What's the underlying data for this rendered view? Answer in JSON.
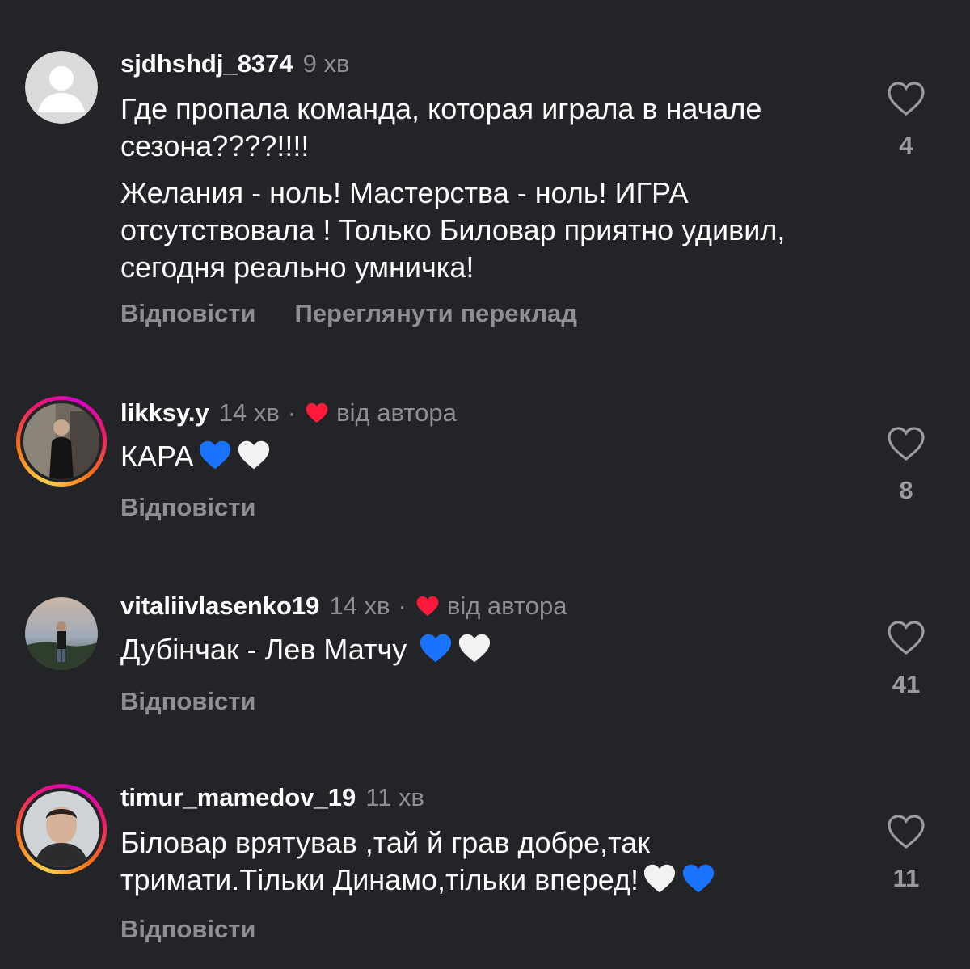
{
  "colors": {
    "background": "#232428",
    "muted_text": "#8e8e93",
    "author_heart": "#ff1a3c",
    "blue_heart": "#1a73ff",
    "white_heart": "#f2f2f2"
  },
  "comments": [
    {
      "username": "sjdhshdj_8374",
      "time": "9 хв",
      "paragraphs": [
        "Где пропала команда, которая играла в начале сезона????!!!!",
        "Желания - ноль! Мастерства - ноль! ИГРА отсутствовала ! Только Биловар приятно удивил, сегодня реально умничка!"
      ],
      "reply_label": "Відповісти",
      "translate_label": "Переглянути переклад",
      "likes": "4",
      "avatar_icon": "default-avatar-icon"
    },
    {
      "username": "likksy.y",
      "time": "14 хв",
      "separator": "·",
      "author_label": "від автора",
      "text": "КАРА",
      "emojis": [
        "blue-heart-icon",
        "white-heart-icon"
      ],
      "reply_label": "Відповісти",
      "likes": "8",
      "avatar_icon": "profile-photo"
    },
    {
      "username": "vitaliivlasenko19",
      "time": "14 хв",
      "separator": "·",
      "author_label": "від автора",
      "text": "Дубінчак - Лев Матчу ",
      "emojis": [
        "blue-heart-icon",
        "white-heart-icon"
      ],
      "reply_label": "Відповісти",
      "likes": "41",
      "avatar_icon": "profile-photo"
    },
    {
      "username": "timur_mamedov_19",
      "time": "11 хв",
      "text_line1": "Біловар врятував ,тай й грав добре,так",
      "text_line2": "тримати.Тільки Динамо,тільки вперед!",
      "emojis": [
        "white-heart-icon",
        "blue-heart-icon"
      ],
      "reply_label": "Відповісти",
      "likes": "11",
      "avatar_icon": "profile-photo"
    }
  ]
}
